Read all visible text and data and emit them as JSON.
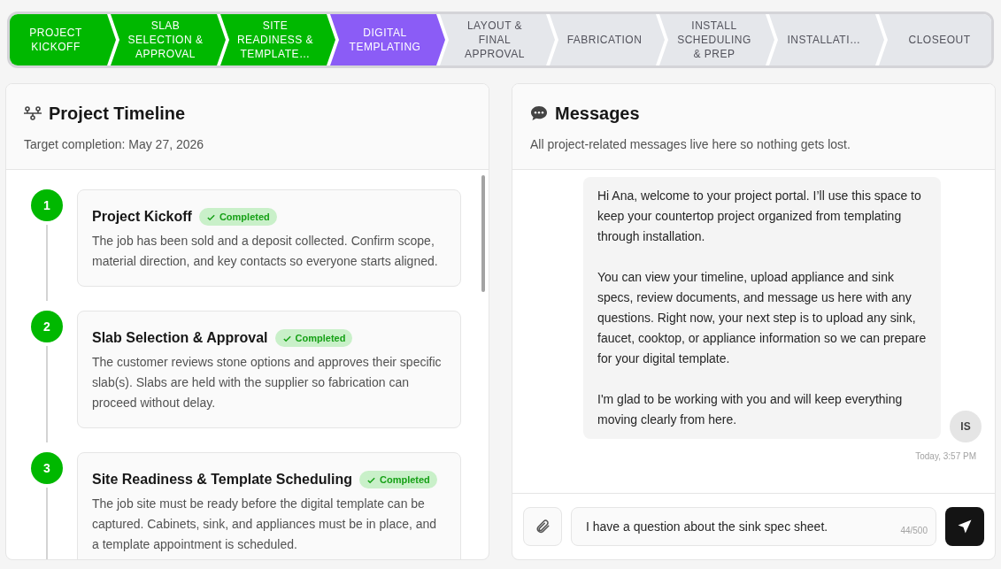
{
  "stepper": [
    {
      "label": "PROJECT KICKOFF",
      "kind": "completed"
    },
    {
      "label": "SLAB SELECTION & APPROVAL",
      "kind": "completed"
    },
    {
      "label": "SITE READINESS & TEMPLATE…",
      "kind": "completed"
    },
    {
      "label": "DIGITAL TEMPLATING",
      "kind": "current"
    },
    {
      "label": "LAYOUT & FINAL APPROVAL",
      "kind": "upcoming"
    },
    {
      "label": "FABRICATION",
      "kind": "upcoming"
    },
    {
      "label": "INSTALL SCHEDULING & PREP",
      "kind": "upcoming"
    },
    {
      "label": "INSTALLATI…",
      "kind": "upcoming"
    },
    {
      "label": "CLOSEOUT",
      "kind": "upcoming"
    }
  ],
  "timeline": {
    "title": "Project Timeline",
    "subtitle": "Target completion: May 27, 2026",
    "items": [
      {
        "number": "1",
        "title": "Project Kickoff",
        "status": "Completed",
        "kind": "completed",
        "description": "The job has been sold and a deposit collected. Confirm scope, material direction, and key contacts so everyone starts aligned."
      },
      {
        "number": "2",
        "title": "Slab Selection & Approval",
        "status": "Completed",
        "kind": "completed",
        "description": "The customer reviews stone options and approves their specific slab(s). Slabs are held with the supplier so fabrication can proceed without delay."
      },
      {
        "number": "3",
        "title": "Site Readiness & Template Scheduling",
        "status": "Completed",
        "kind": "completed",
        "description": "The job site must be ready before the digital template can be captured. Cabinets, sink, and appliances must be in place, and a template appointment is scheduled."
      }
    ]
  },
  "messages": {
    "title": "Messages",
    "subtitle": "All project-related messages live here so nothing gets lost.",
    "items": [
      {
        "paragraphs": [
          "Hi Ana, welcome to your project portal. I’ll use this space to keep your countertop project organized from templating through installation.",
          "You can view your timeline, upload appliance and sink specs, review documents, and message us here with any questions. Right now, your next step is to upload any sink, faucet, cooktop, or appliance information so we can prepare for your digital template.",
          "I'm glad to be working with you and will keep everything moving clearly from here."
        ],
        "avatar": "IS",
        "time": "Today, 3:57 PM"
      }
    ]
  },
  "composer": {
    "value": "I have a question about the sink spec sheet.",
    "count": "44/500"
  }
}
